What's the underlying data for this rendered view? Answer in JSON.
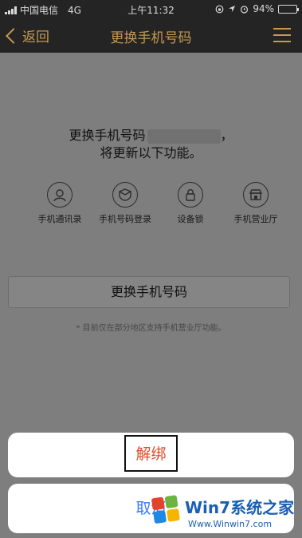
{
  "status_bar": {
    "carrier": "中国电信",
    "network": "4G",
    "time": "上午11:32",
    "battery": "94%",
    "battery_level": 0.94
  },
  "nav": {
    "back_label": "返回",
    "title": "更换手机号码"
  },
  "message": {
    "line1": "更换手机号码",
    "line1_suffix": "，",
    "line2": "将更新以下功能。"
  },
  "features": [
    {
      "label": "手机通讯录",
      "icon": "contacts-icon"
    },
    {
      "label": "手机号码登录",
      "icon": "shield-login-icon"
    },
    {
      "label": "设备锁",
      "icon": "lock-icon"
    },
    {
      "label": "手机营业厅",
      "icon": "store-icon"
    }
  ],
  "change_button_label": "更换手机号码",
  "note": "* 目前仅在部分地区支持手机营业厅功能。",
  "action_sheet": {
    "unbind_label": "解绑",
    "cancel_label": "取消"
  },
  "watermark": {
    "main": "Win7系统之家",
    "url": "Www.Winwin7.com"
  },
  "colors": {
    "nav_bg": "#2b2b2b",
    "nav_accent": "#e6b65c",
    "destructive": "#e04a2a",
    "cancel": "#3478f6"
  }
}
